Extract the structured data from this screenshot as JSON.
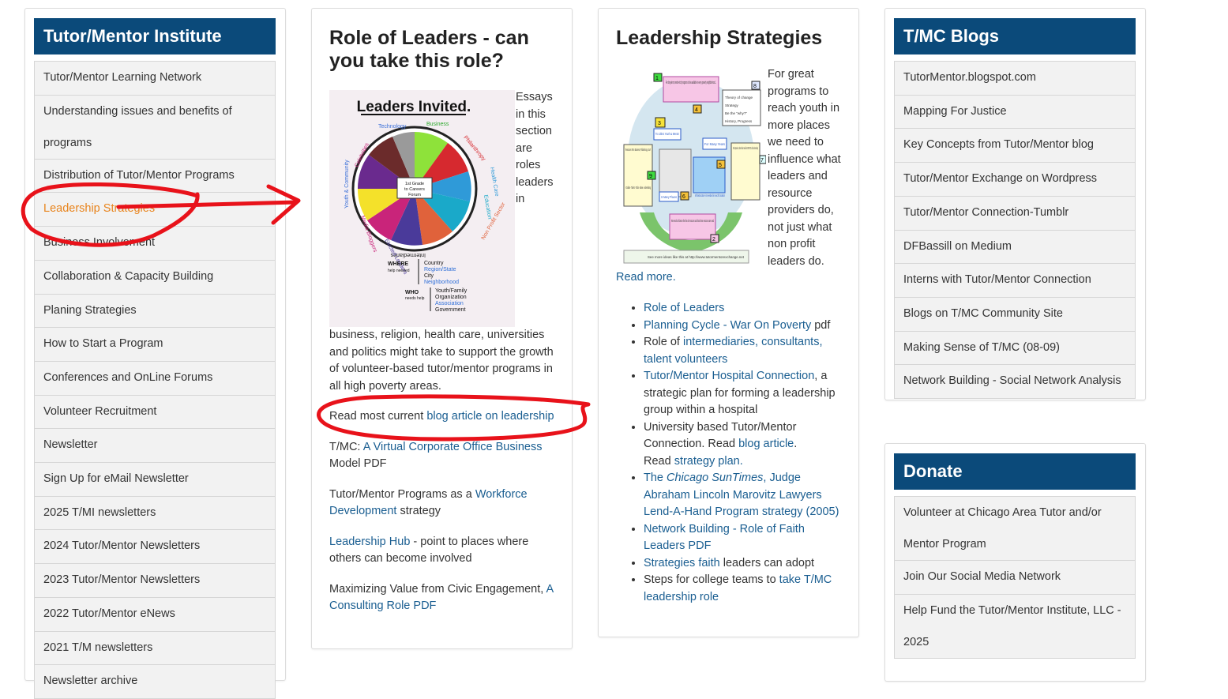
{
  "left_sidebar": {
    "title": "Tutor/Mentor Institute",
    "items": [
      "Tutor/Mentor Learning Network",
      "Understanding issues and benefits of programs",
      "Distribution of Tutor/Mentor Programs",
      "Leadership Strategies",
      "Business Involvement",
      "Collaboration & Capacity Building",
      "Planing Strategies",
      "How to Start a Program",
      "Conferences and OnLine Forums",
      "Volunteer Recruitment",
      "Newsletter",
      "Sign Up for eMail Newsletter",
      "2025 T/MI newsletters",
      "2024 Tutor/Mentor Newsletters",
      "2023 Tutor/Mentor Newsletters",
      "2022 Tutor/Mentor eNews",
      "2021 T/M newsletters",
      "Newsletter archive"
    ],
    "item2_line1": "Understanding issues and benefits of",
    "item2_line2": "programs",
    "active_color": "#e8841d"
  },
  "col2": {
    "title_line1": "Role of Leaders - can",
    "title_line2": "you take this role?",
    "image": {
      "heading": "Leaders Invited.",
      "center_text_1": "1st Grade",
      "center_text_2": "to Careers",
      "center_text_3": "Forum",
      "wedges": [
        "Technology",
        "Business",
        "Philanthropy",
        "Health Care",
        "Education",
        "Non Profit Sector",
        "Intermediaries",
        "Elected Leaders",
        "Media Bloggers",
        "Youth & Community",
        "Celebrities"
      ],
      "where_label": "WHERE",
      "where_sub": "help needed",
      "where_items": [
        "Country",
        "Region/State",
        "City",
        "Neighborhood"
      ],
      "who_label": "WHO",
      "who_sub": "needs help",
      "who_items": [
        "Youth/Family",
        "Organization",
        "Association",
        "Government"
      ]
    },
    "float_lines": [
      "Essays",
      "in this",
      "section",
      "are",
      "roles",
      "leaders",
      "in"
    ],
    "body_lines": [
      "business, religion, health care, universities",
      "and politics might take to support the growth",
      "of volunteer-based tutor/mentor programs  in",
      "all high poverty areas."
    ],
    "read_current_prefix": "Read most current ",
    "read_current_link": "blog article on leadership",
    "tmc_prefix": "T/MC: ",
    "tmc_link": "A Virtual Corporate Office Business",
    "tmc_suffix": "Model PDF",
    "workforce_prefix": "Tutor/Mentor Programs as a  ",
    "workforce_link1": "Workforce",
    "workforce_link2": "Development",
    "workforce_suffix": " strategy",
    "hub_link": "Leadership Hub",
    "hub_suffix1": " - point to places where",
    "hub_suffix2": "others can become involved",
    "civic_prefix": "Maximizing Value from Civic Engagement, ",
    "civic_link1": "A",
    "civic_link2": "Consulting Role PDF"
  },
  "col3": {
    "title": "Leadership Strategies",
    "float_lines": [
      "For great",
      "programs to",
      "reach youth in",
      "more places",
      "we need to",
      "influence what",
      "leaders and",
      "resource",
      "providers do,",
      "not just what",
      "non profit",
      "leaders do."
    ],
    "diagram": {
      "box1": "For long-term, mentor-rich programs to be available in every poverty neighborhood...",
      "box2": "We need to influence the flow of resources and how those resources are used",
      "box3": "To collect Youth & Mentor",
      "box4": "For Many Years",
      "box5": "Infrastructure is needed in each location",
      "box6": "In Many Places",
      "resources": "Resources From Business, Philanthropy, Gov't",
      "resources_list": "-Dollars -Talent -Tools -Ideas -Advertising",
      "talent": "Talent, Experience, Shared Vision needed in EVERY NPO, school & intermediary",
      "theory": [
        "Theory of change",
        "Strategy",
        "Be the \"why?\"",
        "History, Progress"
      ],
      "footer": "See more ideas like this at http://www.tutormentorexchange.net",
      "numbers": [
        "1",
        "2",
        "3",
        "4",
        "5",
        "6",
        "7",
        "8",
        "9"
      ]
    },
    "read_more": "Read more.",
    "list": [
      {
        "link": "Role of Leaders",
        "text": ""
      },
      {
        "link": "Planning Cycle - War On  Poverty",
        "text": " pdf"
      },
      {
        "pre": "Role of ",
        "link": "intermediaries, consultants,",
        "link2": "talent volunteers"
      },
      {
        "link": "Tutor/Mentor Hospital Connection",
        "text": ", a",
        "line2": "strategic plan for forming a leadership",
        "line3": "group within a hospital"
      },
      {
        "pre": "University based Tutor/Mentor",
        "pre2": "Connection. Read ",
        "link": "blog article",
        "text": ".",
        "pre3": "Read ",
        "link2": "strategy plan",
        "text2": "."
      },
      {
        "link": "The Chicago SunTimes, Judge",
        "link2": "Abraham Lincoln Marovitz Lawyers",
        "link3": "Lend-A-Hand Program strategy (2005)"
      },
      {
        "link": "Network Building - Role of Faith",
        "link2": "Leaders PDF"
      },
      {
        "link": "Strategies faith",
        "text": " leaders can adopt"
      },
      {
        "pre": "Steps for college teams to ",
        "link": "take T/MC",
        "link2": "leadership role"
      }
    ],
    "suntimes_the": "The ",
    "suntimes_name": "Chicago SunTimes",
    "suntimes_rest": ", Judge"
  },
  "right_blogs": {
    "title": "T/MC Blogs",
    "items": [
      "TutorMentor.blogspot.com",
      "Mapping For Justice",
      "Key Concepts from Tutor/Mentor blog",
      "Tutor/Mentor Exchange on Wordpress",
      "Tutor/Mentor Connection-Tumblr",
      "DFBassill on Medium",
      "Interns with Tutor/Mentor Connection",
      "Blogs on T/MC Community Site",
      "Making Sense of T/MC (08-09)",
      "Network Building - Social Network Analysis"
    ]
  },
  "right_donate": {
    "title": "Donate",
    "item1_line1": "Volunteer at Chicago Area Tutor and/or",
    "item1_line2": "Mentor Program",
    "item2": "Join Our Social Media Network",
    "item3_line1": "Help Fund the Tutor/Mentor Institute, LLC -",
    "item3_line2": "2025"
  },
  "colors": {
    "header_bg": "#0b4a7a",
    "link": "#1a5e91",
    "annotation_red": "#e8121a",
    "active_item": "#e8841d"
  }
}
